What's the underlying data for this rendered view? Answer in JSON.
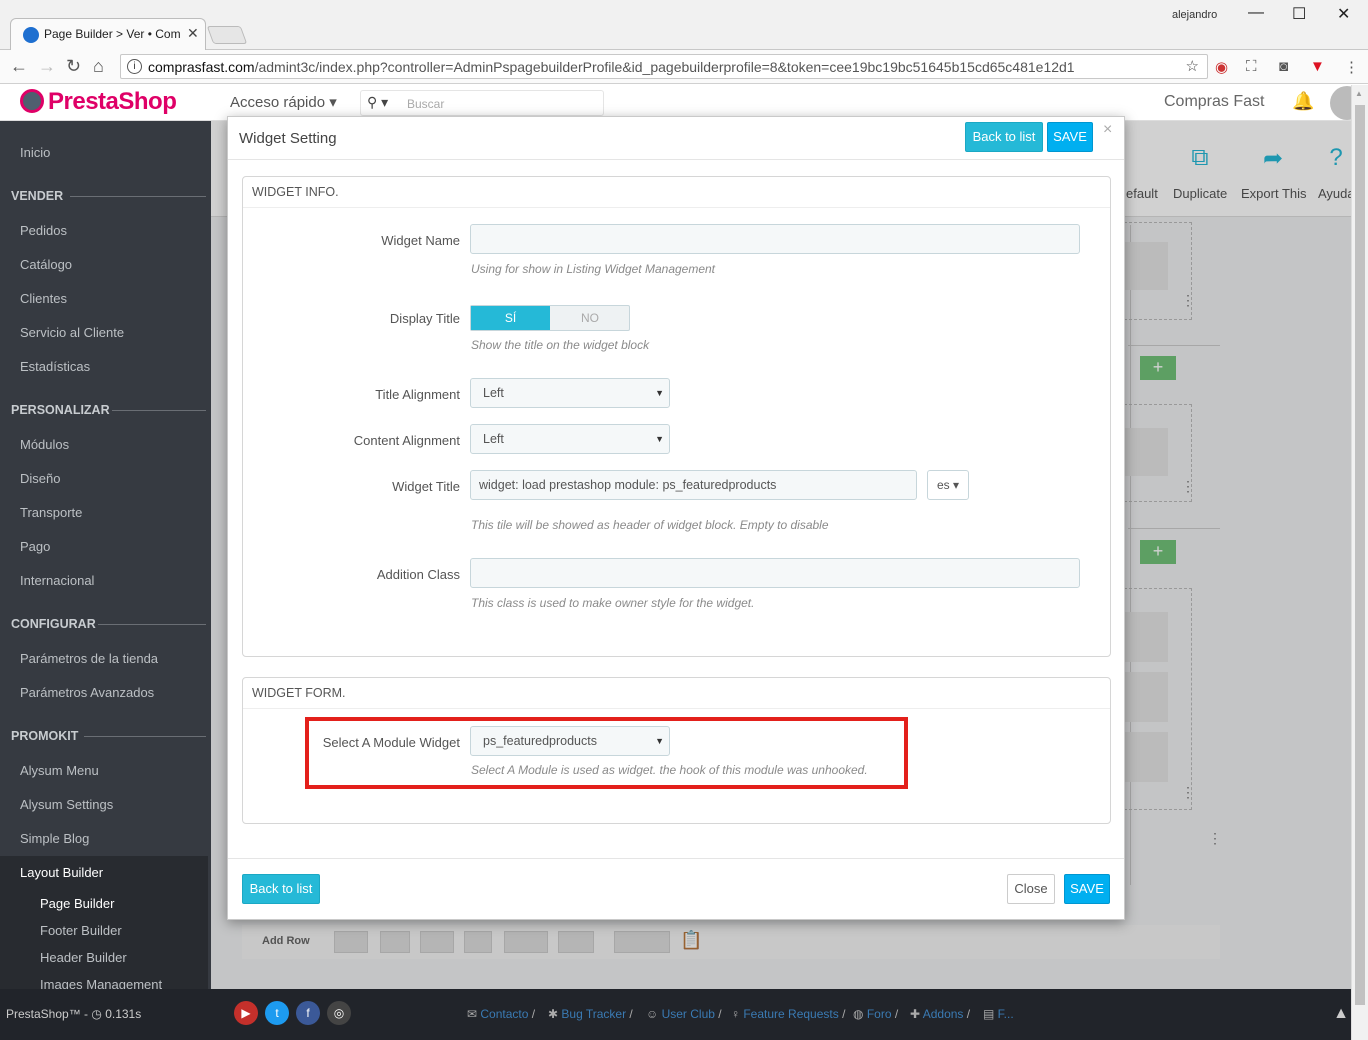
{
  "browser": {
    "tab_title": "Page Builder > Ver • Com",
    "window_user": "alejandro",
    "url_host": "comprasfast.com",
    "url_rest": "/admint3c/index.php?controller=AdminPspagebuilderProfile&id_pagebuilderprofile=8&token=cee19bc19bc51645b15cd65c481e12d1"
  },
  "header": {
    "logo": "PrestaShop",
    "quick_access": "Acceso rápido",
    "search_placeholder": "Buscar",
    "shop_name": "Compras Fast"
  },
  "sidebar": {
    "inicio": "Inicio",
    "vender": "VENDER",
    "pedidos": "Pedidos",
    "catalogo": "Catálogo",
    "clientes": "Clientes",
    "servicio": "Servicio al Cliente",
    "estadisticas": "Estadísticas",
    "personalizar": "PERSONALIZAR",
    "modulos": "Módulos",
    "diseno": "Diseño",
    "transporte": "Transporte",
    "pago": "Pago",
    "internacional": "Internacional",
    "configurar": "CONFIGURAR",
    "parametros_tienda": "Parámetros de la tienda",
    "parametros_avanzados": "Parámetros Avanzados",
    "promokit": "PROMOKIT",
    "alysum_menu": "Alysum Menu",
    "alysum_settings": "Alysum Settings",
    "simple_blog": "Simple Blog",
    "layout_builder": "Layout Builder",
    "page_builder": "Page Builder",
    "footer_builder": "Footer Builder",
    "header_builder": "Header Builder",
    "images_management": "Images Management"
  },
  "toolbar": {
    "default": "efault",
    "duplicate": "Duplicate",
    "export": "Export This",
    "help": "Ayuda"
  },
  "background": {
    "add_row": "Add Row"
  },
  "footer": {
    "version": "PrestaShop™ - ",
    "time": "0.131s",
    "links": [
      "Contacto",
      "Bug Tracker",
      "User Club",
      "Feature Requests",
      "Foro",
      "Addons",
      "F..."
    ]
  },
  "modal": {
    "title": "Widget Setting",
    "back_to_list": "Back to list",
    "save": "SAVE",
    "close_x": "×",
    "widget_info": {
      "heading": "WIDGET INFO.",
      "widget_name_label": "Widget Name",
      "widget_name_value": "",
      "widget_name_help": "Using for show in Listing Widget Management",
      "display_title_label": "Display Title",
      "display_title_on": "SÍ",
      "display_title_off": "NO",
      "display_title_help": "Show the title on the widget block",
      "title_alignment_label": "Title Alignment",
      "title_alignment_value": "Left",
      "content_alignment_label": "Content Alignment",
      "content_alignment_value": "Left",
      "widget_title_label": "Widget Title",
      "widget_title_value": "widget: load prestashop module: ps_featuredproducts",
      "widget_title_lang": "es",
      "widget_title_help": "This tile will be showed as header of widget block. Empty to disable",
      "addition_class_label": "Addition Class",
      "addition_class_value": "",
      "addition_class_help": "This class is used to make owner style for the widget."
    },
    "widget_form": {
      "heading": "WIDGET FORM.",
      "select_label": "Select A Module Widget",
      "select_value": "ps_featuredproducts",
      "select_help": "Select A Module is used as widget. the hook of this module was unhooked."
    },
    "footer_back": "Back to list",
    "footer_close": "Close",
    "footer_save": "SAVE"
  }
}
